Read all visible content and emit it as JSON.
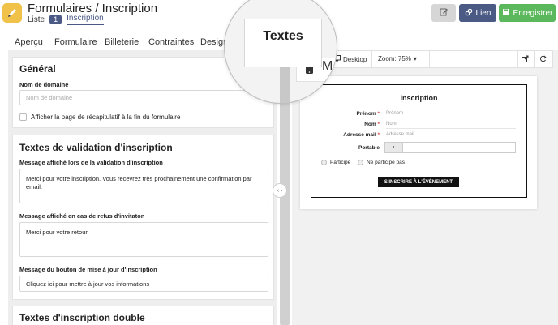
{
  "header": {
    "title": "Formulaires / Inscription",
    "breadcrumb_liste": "Liste",
    "badge": "1",
    "breadcrumb_current": "Inscription",
    "btn_link": "Lien",
    "btn_save": "Enregistrer"
  },
  "tabs": [
    "Aperçu",
    "Formulaire",
    "Billeterie",
    "Contraintes",
    "Design",
    "Textes"
  ],
  "left": {
    "general": {
      "heading": "Général",
      "domain_label": "Nom de domaine",
      "domain_placeholder": "Nom de domaine",
      "recap_label": "Afficher la page de récapitulatif à la fin du formulaire"
    },
    "validation": {
      "heading": "Textes de validation d'inscription",
      "msg1_label": "Message affiché lors de la validation d'inscription",
      "msg1_value": "Merci pour votre inscription. Vous recevrez très prochainement une confirmation par email.",
      "msg2_label": "Message affiché en cas de refus d'invitaton",
      "msg2_value": "Merci pour votre retour.",
      "msg3_label": "Message du bouton de mise à jour d'inscription",
      "msg3_value": "Cliquez ici pour mettre à jour vos informations"
    },
    "double": {
      "heading": "Textes d'inscription double"
    }
  },
  "toolbar": {
    "desktop": "Desktop",
    "zoom": "Zoom: 75%"
  },
  "preview": {
    "title": "Inscription",
    "fields": [
      {
        "label": "Prénom",
        "required": "*",
        "placeholder": "Prénom"
      },
      {
        "label": "Nom",
        "required": "*",
        "placeholder": "Nom"
      },
      {
        "label": "Adresse mail",
        "required": "*",
        "placeholder": "Adresse mail"
      }
    ],
    "phone_label": "Portable",
    "radio1": "Participe",
    "radio2": "Ne participe pas",
    "submit": "S'INSCRIRE À L'ÉVÉNEMENT"
  },
  "colors": {
    "brand_yellow": "#f0c24a",
    "brand_blue": "#4a5a85",
    "save_green": "#5cb85c",
    "required_red": "#d9534f"
  }
}
